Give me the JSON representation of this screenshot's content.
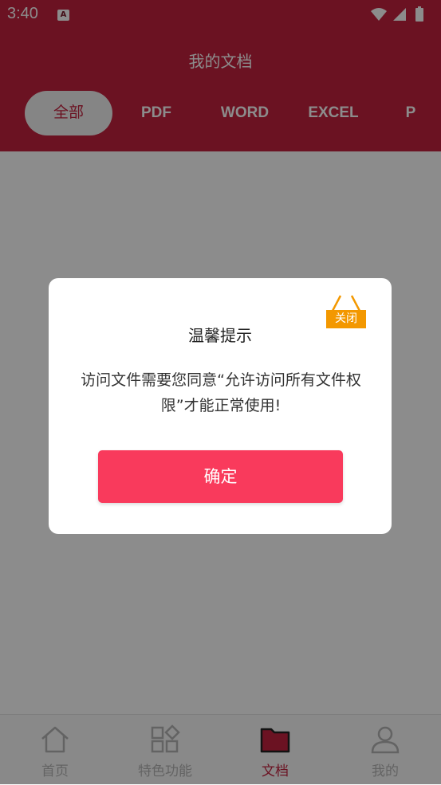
{
  "status_bar": {
    "time": "3:40",
    "notification_icon": "A"
  },
  "header": {
    "title": "我的文档"
  },
  "tabs": [
    {
      "label": "全部",
      "active": true
    },
    {
      "label": "PDF"
    },
    {
      "label": "WORD"
    },
    {
      "label": "EXCEL"
    },
    {
      "label": "P"
    }
  ],
  "bottom_nav": [
    {
      "label": "首页",
      "icon": "home-icon"
    },
    {
      "label": "特色功能",
      "icon": "apps-icon"
    },
    {
      "label": "文档",
      "icon": "folder-icon",
      "active": true
    },
    {
      "label": "我的",
      "icon": "person-icon"
    }
  ],
  "dialog": {
    "title": "温馨提示",
    "message": "访问文件需要您同意“允许访问所有文件权限”才能正常使用!",
    "ok_label": "确定",
    "close_label": "关闭"
  },
  "colors": {
    "brand": "#c4213e",
    "button": "#f93a5c",
    "close_tag": "#f39800"
  }
}
